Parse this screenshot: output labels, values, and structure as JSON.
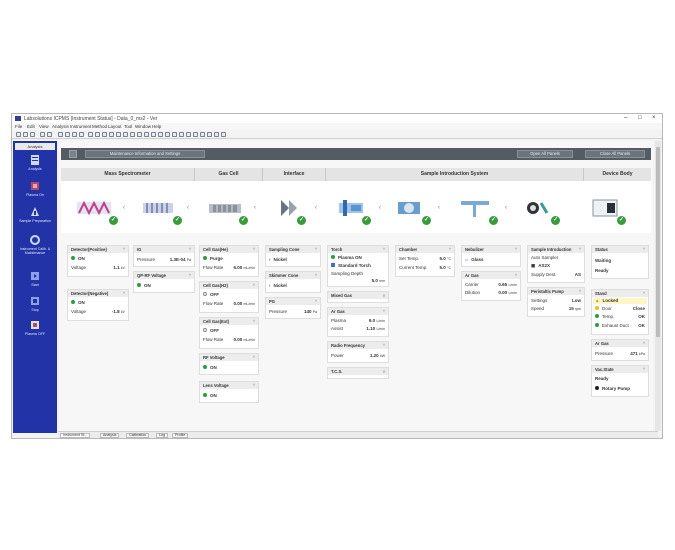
{
  "window": {
    "title": "Labsolutions ICPMS [Instrument Status] - Data_0_ms2 - Ver"
  },
  "menu": [
    "File",
    "Edit",
    "View",
    "Analysis",
    "Instrument",
    "Method",
    "Layout",
    "Tool",
    "Window",
    "Help"
  ],
  "sidebar": {
    "title": "Analysis",
    "items": [
      {
        "label": "Analysis",
        "icon": "analysis-icon"
      },
      {
        "label": "Plasma On",
        "icon": "plasma-on-icon"
      },
      {
        "label": "Sample Preparation",
        "icon": "sample-preparation-icon"
      },
      {
        "label": "Instrument Calib. & Maintenance",
        "icon": "maintenance-icon"
      },
      {
        "label": "Start",
        "icon": "start-icon"
      },
      {
        "label": "Stop",
        "icon": "stop-icon"
      },
      {
        "label": "Plasma OFF",
        "icon": "plasma-off-icon"
      }
    ]
  },
  "header": {
    "maintenance_btn": "Maintenance Information and Settings",
    "open_all": "Open All Panels",
    "close_all": "Close All Panels"
  },
  "sections": [
    "Mass Spectrometer",
    "Gas Cell",
    "Interface",
    "Sample Introduction System",
    "Device Body"
  ],
  "cards": {
    "det_pos": {
      "title": "Detector(Positive)",
      "status": "ON",
      "voltage_label": "Voltage",
      "voltage": "1.1",
      "voltage_unit": "kV"
    },
    "det_neg": {
      "title": "Detector(Negative)",
      "status": "ON",
      "voltage_label": "Voltage",
      "voltage": "-1.8",
      "voltage_unit": "kV"
    },
    "ig": {
      "title": "IG",
      "pressure_label": "Pressure",
      "pressure": "1.3E-04",
      "pressure_unit": "Pa"
    },
    "qprf": {
      "title": "QP-RF Voltage",
      "status": "ON"
    },
    "cellgas_he": {
      "title": "Cell Gas(He)",
      "status": "Purge",
      "flow_label": "Flow Rate",
      "flow": "6.00",
      "flow_unit": "mL/min"
    },
    "cellgas_h2": {
      "title": "Cell Gas(H2)",
      "status": "OFF",
      "flow_label": "Flow Rate",
      "flow": "0.00",
      "flow_unit": "mL/min"
    },
    "cellgas_ext": {
      "title": "Cell Gas(Ext)",
      "status": "OFF",
      "flow_label": "Flow Rate",
      "flow": "0.00",
      "flow_unit": "mL/min"
    },
    "rfvolt": {
      "title": "RF Voltage",
      "status": "ON"
    },
    "lensvolt": {
      "title": "Lens Voltage",
      "status": "ON"
    },
    "sampcone": {
      "title": "Sampling Cone",
      "value": "Nickel"
    },
    "skimcone": {
      "title": "Skimmer Cone",
      "value": "Nickel"
    },
    "pg": {
      "title": "PG",
      "pressure_label": "Pressure",
      "pressure": "140",
      "pressure_unit": "Pa"
    },
    "torch": {
      "title": "Torch",
      "status": "Plasma ON",
      "type": "Standard Torch",
      "depth_label": "Sampling Depth",
      "depth": "5.0",
      "depth_unit": "mm"
    },
    "mixedgas": {
      "title": "Mixed Gas"
    },
    "argas": {
      "title": "Ar Gas",
      "plasma_label": "Plasma",
      "plasma": "9.0",
      "plasma_unit": "L/min",
      "assist_label": "Assist",
      "assist": "1.10",
      "assist_unit": "L/min"
    },
    "radiofreq": {
      "title": "Radio Frequency",
      "power_label": "Power",
      "power": "1.20",
      "power_unit": "kW"
    },
    "tcs": {
      "title": "T.C.S."
    },
    "chamber": {
      "title": "Chamber",
      "set_label": "Set Temp.",
      "set": "5.0",
      "set_unit": "°C",
      "cur_label": "Current Temp.",
      "cur": "5.0",
      "cur_unit": "°C"
    },
    "nebulizer": {
      "title": "Nebulizer",
      "value": "Glass"
    },
    "argas2": {
      "title": "Ar Gas",
      "carrier_label": "Carrier",
      "carrier": "0.65",
      "carrier_unit": "L/min",
      "dilution_label": "Dilution",
      "dilution": "0.00",
      "dilution_unit": "L/min"
    },
    "sampleintro": {
      "title": "Sample Introduction",
      "auto_label": "Auto Sampler",
      "auto": "AS2X",
      "supply_label": "Supply Dest.",
      "supply": "AS"
    },
    "peripump": {
      "title": "Peristaltic Pump",
      "set_label": "Settings",
      "set": "Low",
      "speed_label": "Speed",
      "speed": "15",
      "speed_unit": "rpm"
    },
    "status": {
      "title": "Status",
      "line1": "Waiting",
      "line2": "Ready"
    },
    "stand": {
      "title": "Stand",
      "locked": "Locked",
      "door_label": "Door",
      "door": "Close",
      "temp_label": "Temp.",
      "temp": "OK",
      "exhaust_label": "Exhaust Duct",
      "exhaust": "OK"
    },
    "argas3": {
      "title": "Ar Gas",
      "pressure_label": "Pressure",
      "pressure": "471",
      "pressure_unit": "kPa"
    },
    "vac": {
      "title": "Vac.State",
      "state": "Ready",
      "pump": "Rotary Pump"
    }
  },
  "status_tabs": [
    "Instrument St...",
    "Analysis",
    "Calibration",
    "Log",
    "Profile"
  ],
  "colors": {
    "sidebar": "#2233a8",
    "ok_green": "#3a9a3e",
    "header": "#555b62"
  }
}
